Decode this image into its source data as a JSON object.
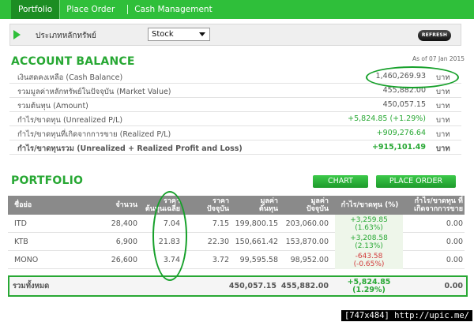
{
  "tabs": [
    {
      "label": "Portfolio"
    },
    {
      "label": "Place Order"
    },
    {
      "label": "Cash Management"
    }
  ],
  "filter": {
    "label": "ประเภทหลักทรัพย์",
    "selected": "Stock",
    "refresh_label": "REFRESH"
  },
  "account": {
    "title": "ACCOUNT BALANCE",
    "as_of": "As of 07 Jan 2015",
    "rows": [
      {
        "label": "เงินสดคงเหลือ (Cash Balance)",
        "value": "1,460,269.93",
        "unit": "บาท",
        "color": "#555555"
      },
      {
        "label": "รวมมูลค่าหลักทรัพย์ในปัจจุบัน (Market Value)",
        "value": "455,882.00",
        "unit": "บาท",
        "color": "#555555"
      },
      {
        "label": "รวมต้นทุน (Amount)",
        "value": "450,057.15",
        "unit": "บาท",
        "color": "#555555"
      },
      {
        "label": "กำไร/ขาดทุน (Unrealized P/L)",
        "value": "+5,824.85 (+1.29%)",
        "unit": "บาท",
        "color": "#28a834"
      },
      {
        "label": "กำไร/ขาดทุนที่เกิดจากการขาย (Realized P/L)",
        "value": "+909,276.64",
        "unit": "บาท",
        "color": "#28a834"
      },
      {
        "label": "กำไร/ขาดทุนรวม (Unrealized + Realized Profit and Loss)",
        "value": "+915,101.49",
        "unit": "บาท",
        "color": "#28a834"
      }
    ]
  },
  "portfolio": {
    "title": "PORTFOLIO",
    "chart_button": "CHART",
    "order_button": "PLACE ORDER",
    "headers": {
      "symbol": "ชื่อย่อ",
      "volume": "จำนวน",
      "avg_cost_1": "ราคา",
      "avg_cost_2": "ต้นทุนเฉลี่ย",
      "market_price_1": "ราคา",
      "market_price_2": "ปัจจุบัน",
      "amount_1": "มูลค่า",
      "amount_2": "ต้นทุน",
      "market_value_1": "มูลค่า",
      "market_value_2": "ปัจจุบัน",
      "unrealized": "กำไร/ขาดทุน (%)",
      "realized_1": "กำไร/ขาดทุน ที่",
      "realized_2": "เกิดจากการขาย"
    },
    "rows": [
      {
        "symbol": "ITD",
        "volume": "28,400",
        "avg_cost": "7.04",
        "market_price": "7.15",
        "amount": "199,800.15",
        "market_value": "203,060.00",
        "pl": "+3,259.85",
        "pl_pct": "(1.63%)",
        "pl_color": "#28a834",
        "realized": "0.00"
      },
      {
        "symbol": "KTB",
        "volume": "6,900",
        "avg_cost": "21.83",
        "market_price": "22.30",
        "amount": "150,661.42",
        "market_value": "153,870.00",
        "pl": "+3,208.58",
        "pl_pct": "(2.13%)",
        "pl_color": "#28a834",
        "realized": "0.00"
      },
      {
        "symbol": "MONO",
        "volume": "26,600",
        "avg_cost": "3.74",
        "market_price": "3.72",
        "amount": "99,595.58",
        "market_value": "98,952.00",
        "pl": "-643.58",
        "pl_pct": "(-0.65%)",
        "pl_color": "#d23a3a",
        "realized": "0.00"
      }
    ],
    "total": {
      "label": "รวมทั้งหมด",
      "amount": "450,057.15",
      "market_value": "455,882.00",
      "pl": "+5,824.85",
      "pl_pct": "(1.29%)",
      "realized": "0.00"
    }
  },
  "footer": {
    "text": "[747x484] http://upic.me/"
  }
}
